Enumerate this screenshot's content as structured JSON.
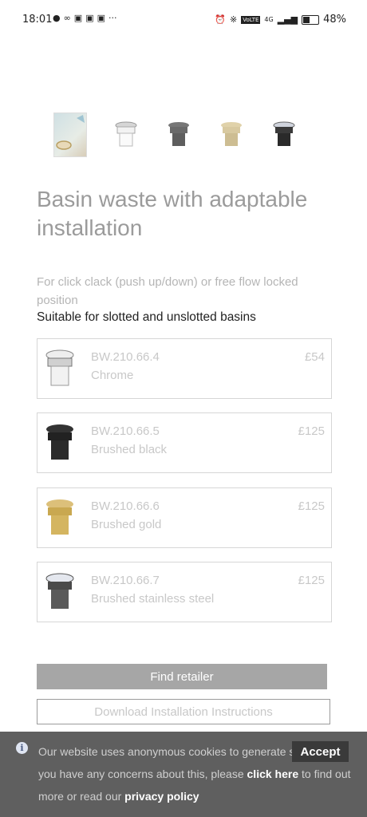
{
  "status_bar": {
    "time": "18:01",
    "left_icons": [
      "messenger-icon",
      "link-icon",
      "instagram-icon",
      "instagram-icon",
      "instagram-icon",
      "more-icon"
    ],
    "right_icons": [
      "alarm-icon",
      "bluetooth-icon",
      "volte-icon",
      "signal-icon",
      "battery-icon"
    ],
    "network": "4G",
    "volte": "VoLTE",
    "battery_percent": "48%"
  },
  "gallery": {
    "thumbnails": [
      {
        "name": "product-photo-thumbnail",
        "color": "#cfe0e4"
      },
      {
        "name": "chrome-thumbnail",
        "color": "#e6e6e6"
      },
      {
        "name": "grey-thumbnail",
        "color": "#6e6e6e"
      },
      {
        "name": "gold-thumbnail",
        "color": "#d8c9a0"
      },
      {
        "name": "black-thumbnail",
        "color": "#2a2a2a"
      }
    ]
  },
  "product": {
    "title": "Basin waste with adaptable installation",
    "subtitle": "For click clack (push up/down) or free flow locked position",
    "suitable": "Suitable for slotted and unslotted basins"
  },
  "variants": [
    {
      "code": "BW.210.66.4",
      "name": "Chrome",
      "price": "£54",
      "color": "#e8e8e8"
    },
    {
      "code": "BW.210.66.5",
      "name": "Brushed black",
      "price": "£125",
      "color": "#2b2b2b"
    },
    {
      "code": "BW.210.66.6",
      "name": "Brushed gold",
      "price": "£125",
      "color": "#c9a850"
    },
    {
      "code": "BW.210.66.7",
      "name": "Brushed stainless steel",
      "price": "£125",
      "color": "#5a5a5a"
    }
  ],
  "actions": {
    "find_retailer": "Find retailer",
    "download_instructions": "Download Installation Instructions"
  },
  "cookie_banner": {
    "text_1": "Our website uses anonymous cookies to generate statistics. If you have any concerns about this, please",
    "click_here": "click here",
    "text_2": "to find out more or read our",
    "privacy_policy": "privacy policy",
    "accept": "Accept"
  }
}
